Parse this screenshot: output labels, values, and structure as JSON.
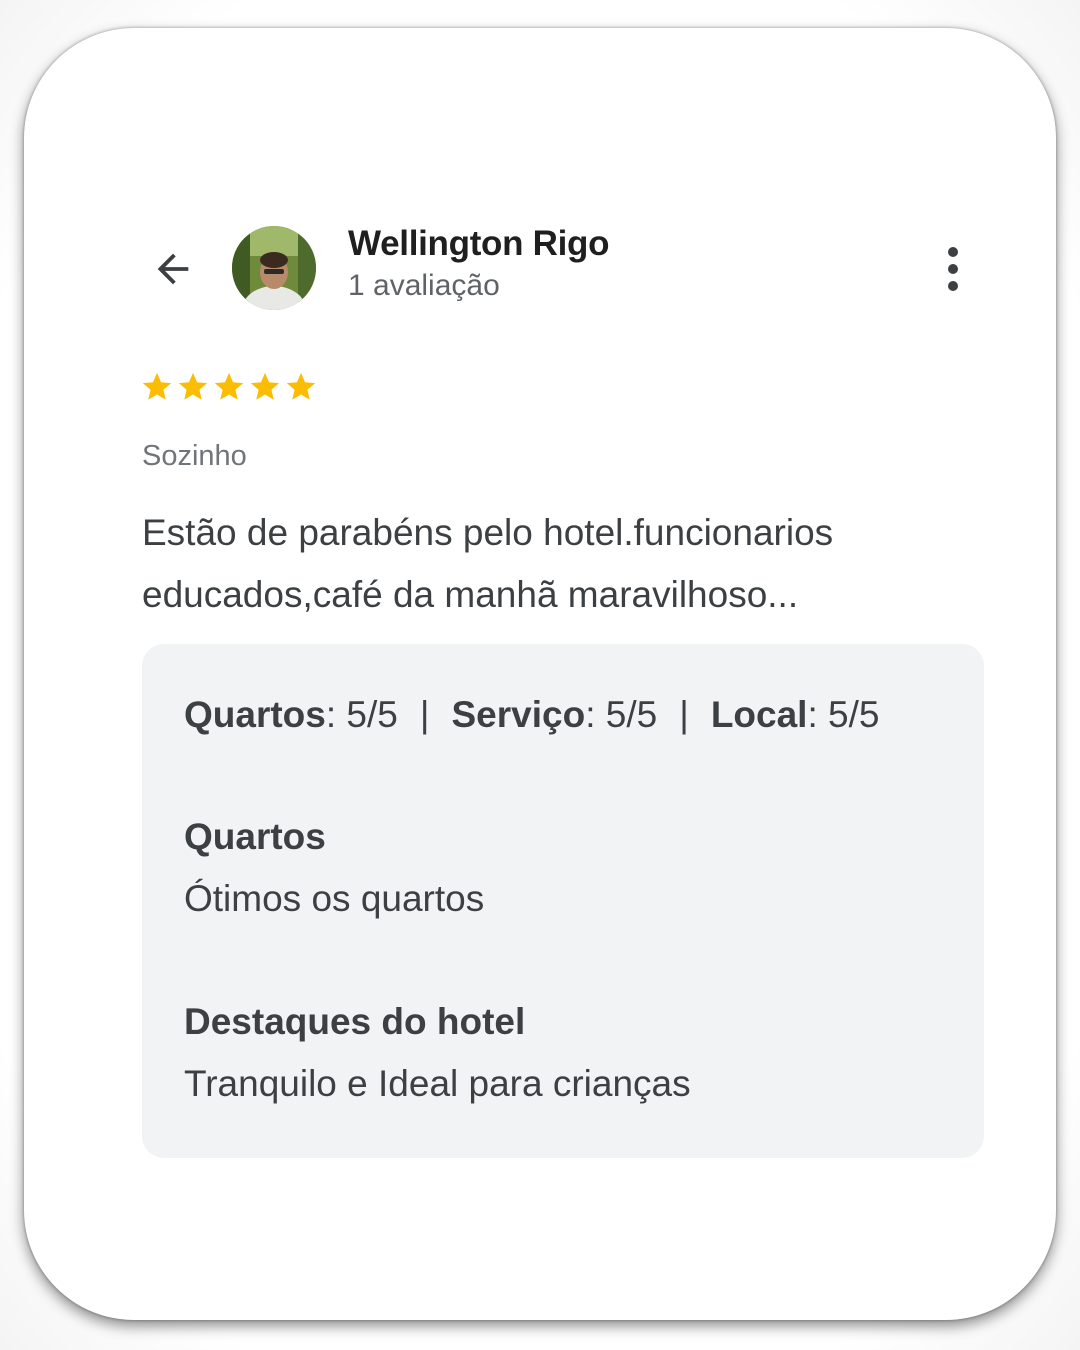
{
  "header": {
    "back_icon": "arrow-back-icon",
    "user_name": "Wellington Rigo",
    "user_meta": "1 avaliação",
    "more_icon": "more-vertical-icon"
  },
  "review": {
    "rating": 5,
    "rating_max": 5,
    "star_color": "#fbbc04",
    "trip_type": "Sozinho",
    "text": "Estão de parabéns pelo hotel.funcionarios educados,café da manhã maravilhoso..."
  },
  "details": {
    "ratings": [
      {
        "label": "Quartos",
        "value": ": 5/5"
      },
      {
        "label": "Serviço",
        "value": ": 5/5"
      },
      {
        "label": "Local",
        "value": ": 5/5"
      }
    ],
    "separator": "|",
    "sections": [
      {
        "title": "Quartos",
        "body": "Ótimos os quartos"
      },
      {
        "title": "Destaques do hotel",
        "body": "Tranquilo e Ideal para crianças"
      }
    ]
  }
}
